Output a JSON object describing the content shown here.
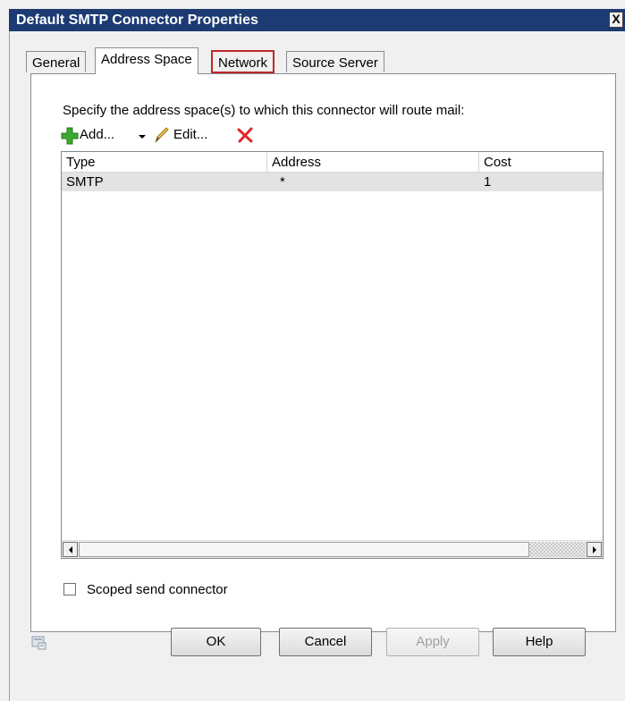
{
  "window": {
    "title": "Default SMTP Connector Properties",
    "close_label": "X"
  },
  "tabs": [
    {
      "label": "General",
      "active": false
    },
    {
      "label": "Address Space",
      "active": true
    },
    {
      "label": "Network",
      "active": false,
      "highlighted": true
    },
    {
      "label": "Source Server",
      "active": false
    }
  ],
  "address_space": {
    "description": "Specify the address space(s) to which this connector will route mail:",
    "toolbar": {
      "add_label": "Add...",
      "edit_label": "Edit...",
      "icons": [
        "add-icon",
        "dropdown-arrow-icon",
        "edit-pencil-icon",
        "remove-x-icon"
      ]
    },
    "columns": [
      "Type",
      "Address",
      "Cost"
    ],
    "rows": [
      {
        "type": "SMTP",
        "address": "*",
        "cost": "1",
        "selected": true
      }
    ]
  },
  "scoped_send_connector": {
    "label": "Scoped send connector",
    "checked": false
  },
  "buttons": {
    "ok": "OK",
    "cancel": "Cancel",
    "apply": "Apply",
    "help": "Help"
  },
  "colors": {
    "titlebar": "#1c3b73",
    "tab_highlight": "#c0262d",
    "add_icon": "#3aa92e",
    "remove_icon": "#e0272c"
  }
}
